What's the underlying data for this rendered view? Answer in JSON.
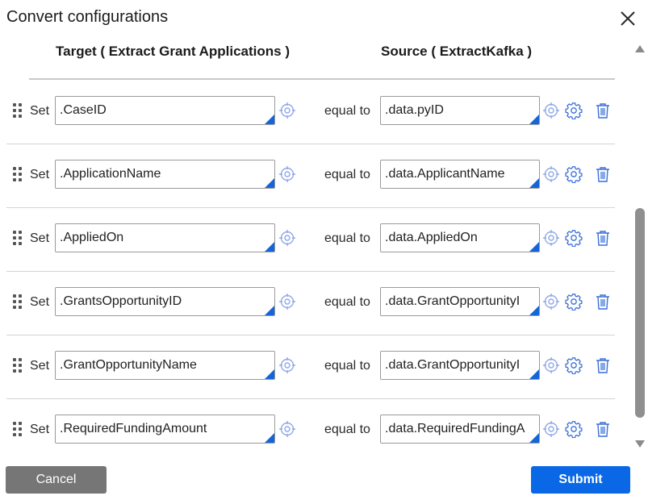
{
  "dialog": {
    "title": "Convert configurations",
    "close_icon": "close-icon"
  },
  "columns": {
    "target": "Target ( Extract Grant Applications )",
    "source": "Source ( ExtractKafka )"
  },
  "row_labels": {
    "set": "Set",
    "equal_to": "equal to"
  },
  "rows": [
    {
      "target": ".CaseID",
      "source": ".data.pyID"
    },
    {
      "target": ".ApplicationName",
      "source": ".data.ApplicantName"
    },
    {
      "target": ".AppliedOn",
      "source": ".data.AppliedOn"
    },
    {
      "target": ".GrantsOpportunityID",
      "source": ".data.GrantOpportunityI"
    },
    {
      "target": ".GrantOpportunityName",
      "source": ".data.GrantOpportunityI"
    },
    {
      "target": ".RequiredFundingAmount",
      "source": ".data.RequiredFundingA"
    }
  ],
  "footer": {
    "cancel_label": "Cancel",
    "submit_label": "Submit"
  },
  "colors": {
    "accent": "#0a68e6",
    "cancel": "#767676",
    "icon": "#3a6fd8"
  }
}
